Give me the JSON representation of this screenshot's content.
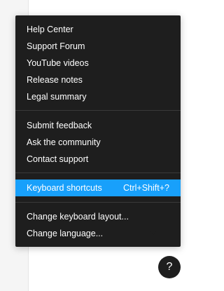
{
  "menu": {
    "section1": [
      "Help Center",
      "Support Forum",
      "YouTube videos",
      "Release notes",
      "Legal summary"
    ],
    "section2": [
      "Submit feedback",
      "Ask the community",
      "Contact support"
    ],
    "section3": {
      "label": "Keyboard shortcuts",
      "shortcut": "Ctrl+Shift+?"
    },
    "section4": [
      "Change keyboard layout...",
      "Change language..."
    ]
  },
  "help_button": {
    "label": "?"
  },
  "colors": {
    "menu_bg": "#1e1e1e",
    "highlight": "#18a0fb",
    "text": "#ffffff",
    "divider": "#3a3a3a"
  }
}
